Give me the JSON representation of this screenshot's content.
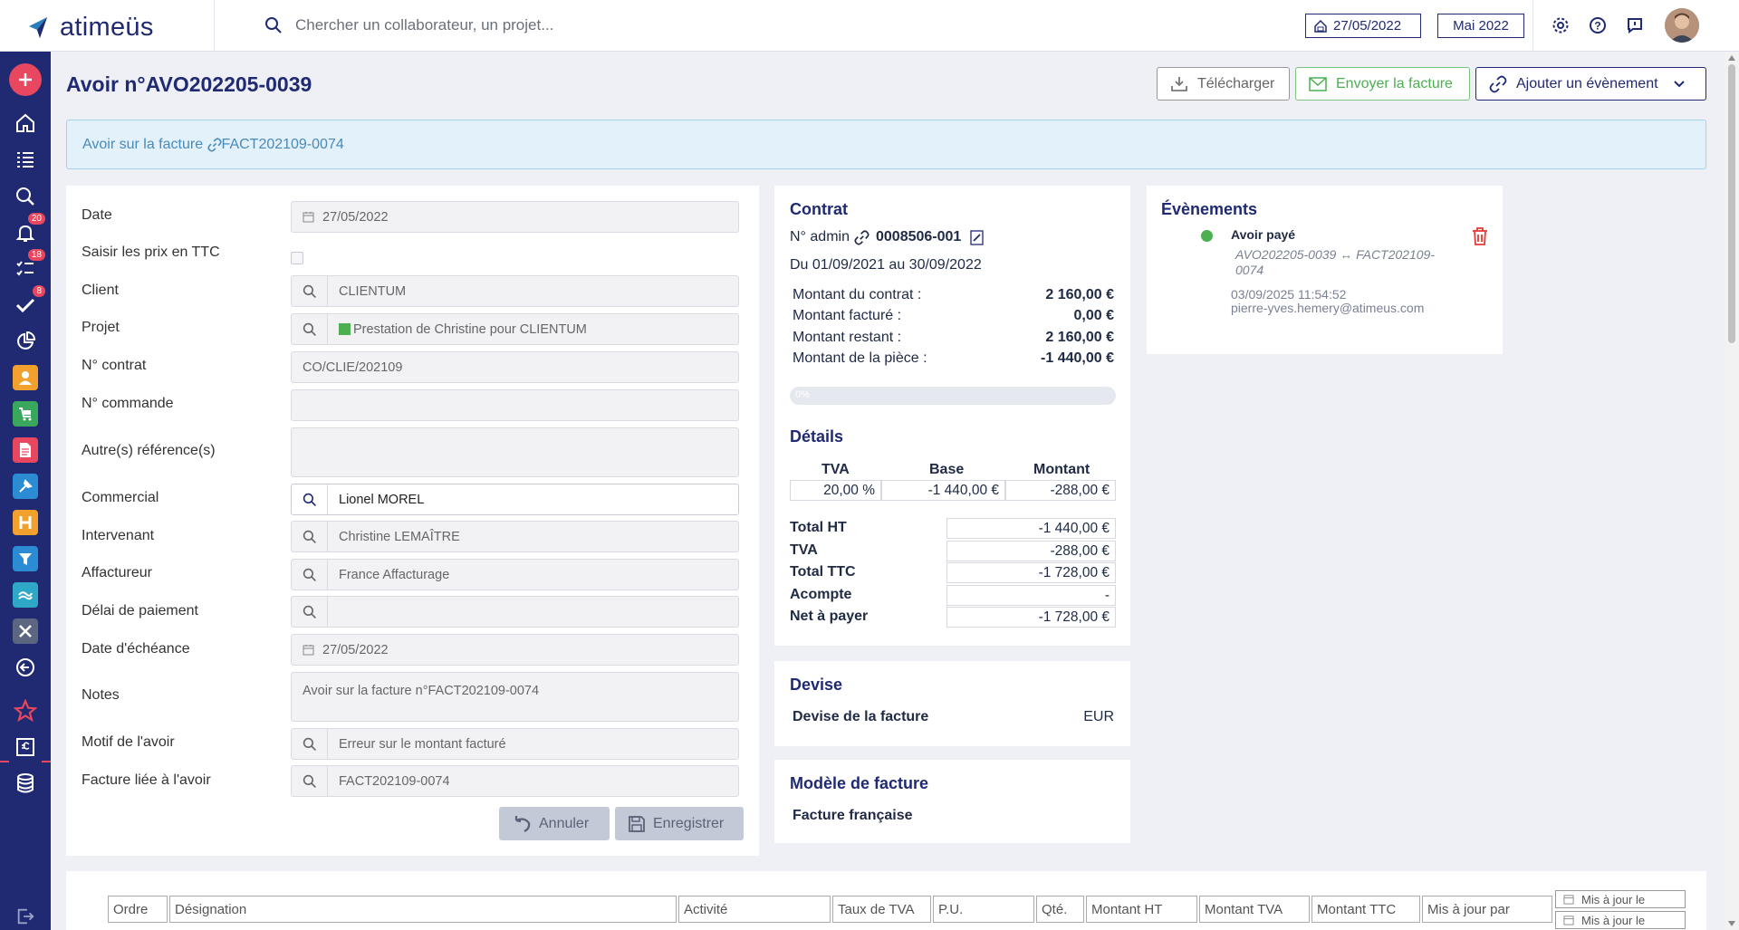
{
  "header": {
    "logo_text": "atimeüs",
    "search_placeholder": "Chercher un collaborateur, un projet...",
    "date": "27/05/2022",
    "period": "Mai 2022"
  },
  "sidebar": {
    "badges": {
      "notifications": "20",
      "tasks": "18",
      "validations": "8"
    }
  },
  "page": {
    "title": "Avoir n°AVO202205-0039",
    "download_label": "Télécharger",
    "send_label": "Envoyer la facture",
    "add_event_label": "Ajouter un évènement",
    "alert_prefix": "Avoir sur la facture ",
    "alert_link": "FACT202109-0074"
  },
  "form": {
    "date_label": "Date",
    "date_value": "27/05/2022",
    "ttc_label": "Saisir les prix en TTC",
    "client_label": "Client",
    "client_value": "CLIENTUM",
    "projet_label": "Projet",
    "projet_value": "Prestation de Christine pour CLIENTUM",
    "contrat_label": "N° contrat",
    "contrat_value": "CO/CLIE/202109",
    "commande_label": "N° commande",
    "commande_value": "",
    "refs_label": "Autre(s) référence(s)",
    "refs_value": "",
    "commercial_label": "Commercial",
    "commercial_value": "Lionel MOREL",
    "intervenant_label": "Intervenant",
    "intervenant_value": "Christine LEMAÎTRE",
    "affacturage_label": "Affactureur",
    "affacturage_value": "France Affacturage",
    "delai_label": "Délai de paiement",
    "delai_value": "",
    "echeance_label": "Date d'échéance",
    "echeance_value": "27/05/2022",
    "notes_label": "Notes",
    "notes_value": "Avoir sur la facture n°FACT202109-0074",
    "motif_label": "Motif de l'avoir",
    "motif_value": "Erreur sur le montant facturé",
    "facture_liee_label": "Facture liée à l'avoir",
    "facture_liee_value": "FACT202109-0074",
    "cancel_label": "Annuler",
    "save_label": "Enregistrer"
  },
  "contrat": {
    "title": "Contrat",
    "admin_label": "N° admin",
    "admin_value": "0008506-001",
    "periode": "Du 01/09/2021 au 30/09/2022",
    "rows": [
      {
        "label": "Montant du contrat :",
        "value": "2 160,00 €"
      },
      {
        "label": "Montant facturé :",
        "value": "0,00 €"
      },
      {
        "label": "Montant restant :",
        "value": "2 160,00 €"
      },
      {
        "label": "Montant de la pièce :",
        "value": "-1 440,00 €"
      }
    ],
    "progress_label": "0%",
    "progress_value": 0
  },
  "details": {
    "title": "Détails",
    "col_tva": "TVA",
    "col_base": "Base",
    "col_montant": "Montant",
    "tva": "20,00 %",
    "base": "-1 440,00 €",
    "montant": "-288,00 €",
    "totals": [
      {
        "label": "Total HT",
        "value": "-1 440,00 €"
      },
      {
        "label": "TVA",
        "value": "-288,00 €"
      },
      {
        "label": "Total TTC",
        "value": "-1 728,00 €"
      },
      {
        "label": "Acompte",
        "value": "-"
      },
      {
        "label": "Net à payer",
        "value": "-1 728,00 €"
      }
    ]
  },
  "devise": {
    "title": "Devise",
    "label": "Devise de la facture",
    "value": "EUR"
  },
  "modele": {
    "title": "Modèle de facture",
    "value": "Facture française"
  },
  "evenements": {
    "title": "Évènements",
    "event_title": "Avoir payé",
    "event_desc": "AVO202205-0039 ↔ FACT202109-0074",
    "event_date": "03/09/2025 11:54:52",
    "event_user": "pierre-yves.hemery@atimeus.com"
  },
  "lines_table": {
    "headers": [
      "Ordre",
      "Désignation",
      "Activité",
      "Taux de TVA",
      "P.U.",
      "Qté.",
      "Montant HT",
      "Montant TVA",
      "Montant TTC",
      "Mis à jour par"
    ],
    "date_filter_label": "Mis à jour le"
  },
  "colors": {
    "primary": "#1f2a72",
    "accent": "#e8475f",
    "success": "#4caf50"
  }
}
